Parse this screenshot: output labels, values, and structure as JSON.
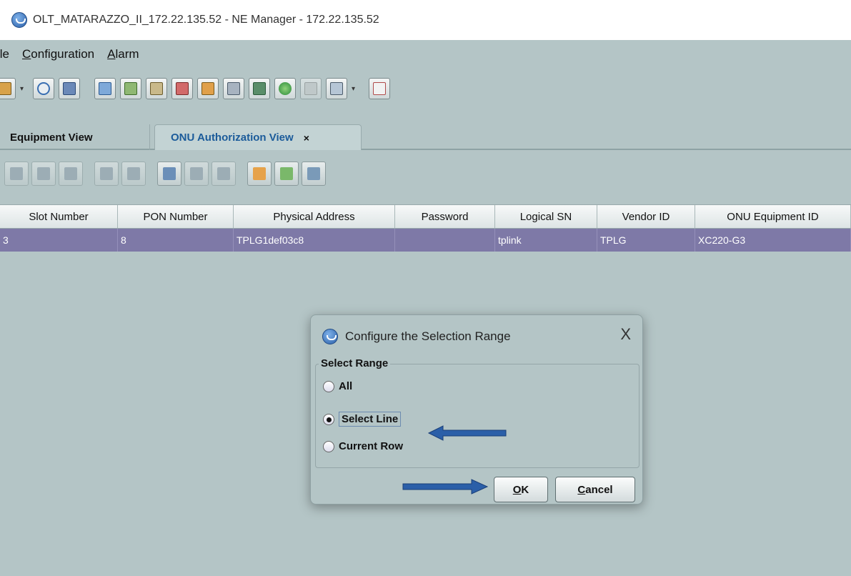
{
  "window": {
    "title": "OLT_MATARAZZO_II_172.22.135.52 - NE Manager - 172.22.135.52"
  },
  "menubar": {
    "items": [
      {
        "mnemonic": "F",
        "label": "ile",
        "visible": "ile"
      },
      {
        "mnemonic": "C",
        "label": "onfiguration"
      },
      {
        "mnemonic": "A",
        "label": "larm"
      }
    ]
  },
  "tabs": {
    "equipment": "Equipment View",
    "onu": "ONU Authorization View",
    "close_glyph": "×"
  },
  "table": {
    "columns": [
      "Slot Number",
      "PON Number",
      "Physical Address",
      "Password",
      "Logical SN",
      "Vendor ID",
      "ONU Equipment ID"
    ],
    "rows": [
      [
        "3",
        "8",
        "TPLG1def03c8",
        "",
        "tplink",
        "TPLG",
        "XC220-G3"
      ]
    ]
  },
  "dialog": {
    "title": "Configure the Selection Range",
    "close_glyph": "X",
    "group_label": "Select Range",
    "options": [
      "All",
      "Select Line",
      "Current Row"
    ],
    "selected_option": "Select Line",
    "ok_mnemonic": "O",
    "ok_rest": "K",
    "cancel_mnemonic": "C",
    "cancel_rest": "ancel"
  },
  "colors": {
    "background": "#b4c5c6",
    "selected_row": "#7e79a7",
    "annotation_arrow": "#2b5fa8"
  }
}
